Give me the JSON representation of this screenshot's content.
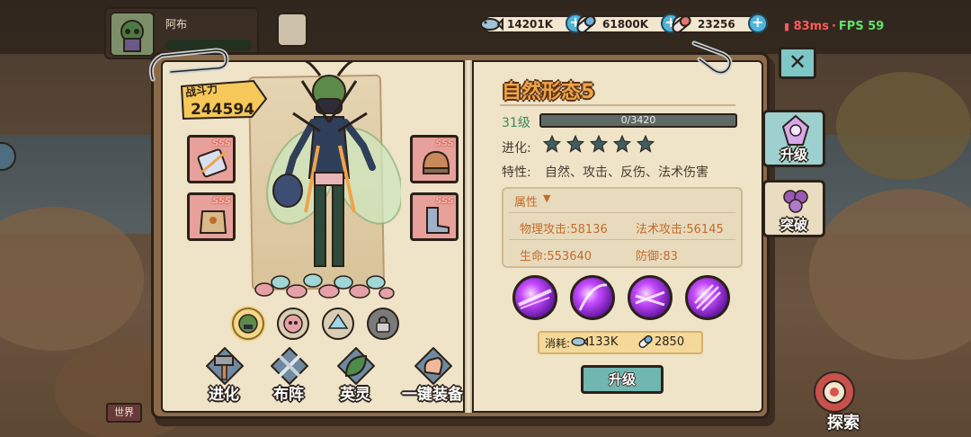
{
  "player": {
    "name": "阿布"
  },
  "currencies": [
    {
      "icon": "fish-icon",
      "value": "14201K"
    },
    {
      "icon": "capsule-blue-icon",
      "value": "61800K"
    },
    {
      "icon": "capsule-red-icon",
      "value": "23256"
    }
  ],
  "network": {
    "ping": "83ms",
    "fps_label": "FPS 59"
  },
  "left_page": {
    "power_label": "战斗力",
    "power_value": "244594",
    "equipment_grades": [
      "SSS",
      "SSS",
      "SSS",
      "SSS"
    ],
    "actions": [
      {
        "label": "进化",
        "icon": "hammer-icon"
      },
      {
        "label": "布阵",
        "icon": "sword-icon"
      },
      {
        "label": "英灵",
        "icon": "leaf-icon"
      },
      {
        "label": "一键装备",
        "icon": "hand-icon"
      }
    ]
  },
  "right_page": {
    "title": "自然形态5",
    "level": "31级",
    "xp": "0/3420",
    "xp_fraction": 0,
    "evolution_label": "进化:",
    "stars": 5,
    "traits_label": "特性:",
    "traits": "自然、攻击、反伤、法术伤害",
    "attributes_title": "属性",
    "attributes": {
      "phys_attack": "物理攻击:58136",
      "magic_attack": "法术攻击:56145",
      "hp": "生命:553640",
      "defense": "防御:83"
    },
    "cost_label": "消耗:",
    "cost_fish": "133K",
    "cost_capsule": "2850",
    "upgrade_button": "升级"
  },
  "side_tabs": {
    "upgrade": "升级",
    "break": "突破"
  },
  "bottom": {
    "chat_channel": "世界",
    "explore": "探索"
  },
  "colors": {
    "accent_title": "#f0a44a",
    "attribute_text": "#c46a2a",
    "level_green": "#3a8a5a",
    "fps_green": "#5fe36a",
    "ping_red": "#ff5a5a"
  }
}
